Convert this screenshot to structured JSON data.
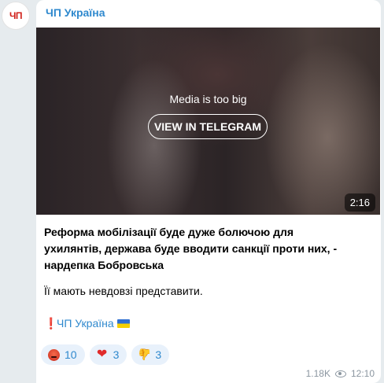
{
  "channel": {
    "name": "ЧП Україна",
    "avatar_text": "ЧП"
  },
  "media": {
    "notice": "Media is too big",
    "button_label": "VIEW IN TELEGRAM",
    "duration": "2:16"
  },
  "post": {
    "headline": "Реформа мобілізації буде дуже болючою для ухилянтів, держава буде вводити санкції проти них, - нардепка Бобровська",
    "paragraph": "Її мають невдовзі представити.",
    "signature_mark": "❗",
    "signature_link": "ЧП Україна",
    "signature_flag_icon": "ukraine-flag-icon"
  },
  "reactions": [
    {
      "icon": "angry-face-icon",
      "count": "10"
    },
    {
      "icon": "heart-icon",
      "count": "3"
    },
    {
      "icon": "thumbs-down-icon",
      "count": "3"
    }
  ],
  "meta": {
    "views": "1.18K",
    "time": "12:10"
  },
  "colors": {
    "accent": "#2f89ce",
    "brand_red": "#d0211b",
    "background": "#e6ebee",
    "reaction_bg": "#e8f1fb"
  }
}
